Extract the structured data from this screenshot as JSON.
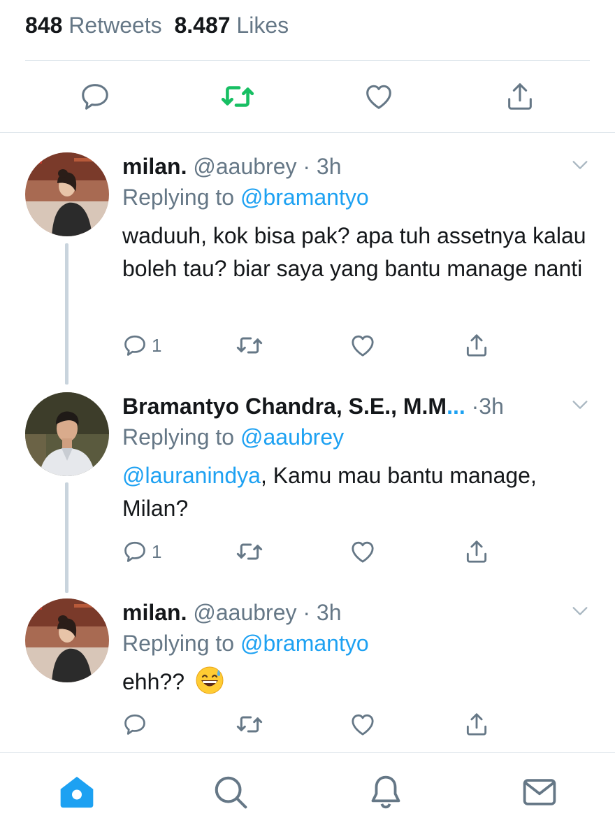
{
  "stats": {
    "retweets_count": "848",
    "retweets_label": "Retweets",
    "likes_count": "8.487",
    "likes_label": "Likes"
  },
  "main_actions": {
    "icons": [
      "reply-icon",
      "retweet-icon",
      "like-icon",
      "share-icon"
    ],
    "retweet_active_color": "#17bf63"
  },
  "tweets": [
    {
      "name": "milan.",
      "handle": "@aaubrey",
      "dot": "·",
      "time": "3h",
      "replying_prefix": "Replying to ",
      "replying_to": "@bramantyo",
      "body_mention": "",
      "body_text": "waduuh, kok bisa pak? apa tuh assetnya kalau boleh tau? biar saya yang bantu manage nanti",
      "reply_count": "1"
    },
    {
      "name": "Bramantyo Chandra, S.E., M.M",
      "name_ellipsis": "...",
      "dot": "·",
      "time": "3h",
      "replying_prefix": "Replying to ",
      "replying_to": "@aaubrey",
      "body_mention": "@lauranindya",
      "body_text": ", Kamu mau bantu manage, Milan?",
      "reply_count": "1"
    },
    {
      "name": "milan.",
      "handle": "@aaubrey",
      "dot": "·",
      "time": "3h",
      "replying_prefix": "Replying to ",
      "replying_to": "@bramantyo",
      "body_mention": "",
      "body_text": "ehh?? ",
      "body_emoji": "grinning-face-with-sweat-emoji",
      "reply_count": ""
    }
  ],
  "tabbar": {
    "tabs": [
      "home-icon",
      "search-icon",
      "notifications-icon",
      "messages-icon"
    ],
    "active_color": "#1da1f2",
    "inactive_color": "#657786"
  },
  "colors": {
    "link": "#1da1f2",
    "muted": "#657786",
    "text": "#14171a",
    "divider": "#e1e8ed",
    "thread_line": "#c9d4dd"
  }
}
